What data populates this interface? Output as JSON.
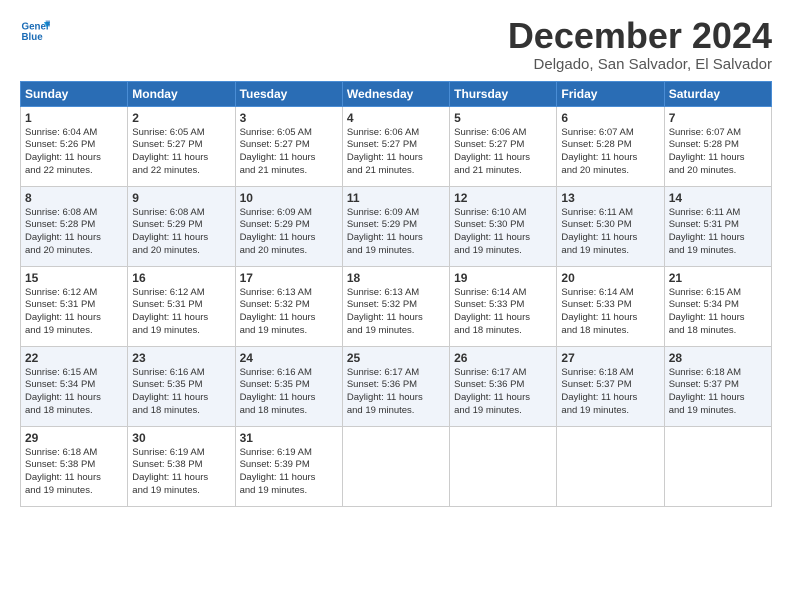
{
  "logo": {
    "line1": "General",
    "line2": "Blue"
  },
  "title": "December 2024",
  "location": "Delgado, San Salvador, El Salvador",
  "days_header": [
    "Sunday",
    "Monday",
    "Tuesday",
    "Wednesday",
    "Thursday",
    "Friday",
    "Saturday"
  ],
  "weeks": [
    [
      {
        "day": "1",
        "info": "Sunrise: 6:04 AM\nSunset: 5:26 PM\nDaylight: 11 hours\nand 22 minutes."
      },
      {
        "day": "2",
        "info": "Sunrise: 6:05 AM\nSunset: 5:27 PM\nDaylight: 11 hours\nand 22 minutes."
      },
      {
        "day": "3",
        "info": "Sunrise: 6:05 AM\nSunset: 5:27 PM\nDaylight: 11 hours\nand 21 minutes."
      },
      {
        "day": "4",
        "info": "Sunrise: 6:06 AM\nSunset: 5:27 PM\nDaylight: 11 hours\nand 21 minutes."
      },
      {
        "day": "5",
        "info": "Sunrise: 6:06 AM\nSunset: 5:27 PM\nDaylight: 11 hours\nand 21 minutes."
      },
      {
        "day": "6",
        "info": "Sunrise: 6:07 AM\nSunset: 5:28 PM\nDaylight: 11 hours\nand 20 minutes."
      },
      {
        "day": "7",
        "info": "Sunrise: 6:07 AM\nSunset: 5:28 PM\nDaylight: 11 hours\nand 20 minutes."
      }
    ],
    [
      {
        "day": "8",
        "info": "Sunrise: 6:08 AM\nSunset: 5:28 PM\nDaylight: 11 hours\nand 20 minutes."
      },
      {
        "day": "9",
        "info": "Sunrise: 6:08 AM\nSunset: 5:29 PM\nDaylight: 11 hours\nand 20 minutes."
      },
      {
        "day": "10",
        "info": "Sunrise: 6:09 AM\nSunset: 5:29 PM\nDaylight: 11 hours\nand 20 minutes."
      },
      {
        "day": "11",
        "info": "Sunrise: 6:09 AM\nSunset: 5:29 PM\nDaylight: 11 hours\nand 19 minutes."
      },
      {
        "day": "12",
        "info": "Sunrise: 6:10 AM\nSunset: 5:30 PM\nDaylight: 11 hours\nand 19 minutes."
      },
      {
        "day": "13",
        "info": "Sunrise: 6:11 AM\nSunset: 5:30 PM\nDaylight: 11 hours\nand 19 minutes."
      },
      {
        "day": "14",
        "info": "Sunrise: 6:11 AM\nSunset: 5:31 PM\nDaylight: 11 hours\nand 19 minutes."
      }
    ],
    [
      {
        "day": "15",
        "info": "Sunrise: 6:12 AM\nSunset: 5:31 PM\nDaylight: 11 hours\nand 19 minutes."
      },
      {
        "day": "16",
        "info": "Sunrise: 6:12 AM\nSunset: 5:31 PM\nDaylight: 11 hours\nand 19 minutes."
      },
      {
        "day": "17",
        "info": "Sunrise: 6:13 AM\nSunset: 5:32 PM\nDaylight: 11 hours\nand 19 minutes."
      },
      {
        "day": "18",
        "info": "Sunrise: 6:13 AM\nSunset: 5:32 PM\nDaylight: 11 hours\nand 19 minutes."
      },
      {
        "day": "19",
        "info": "Sunrise: 6:14 AM\nSunset: 5:33 PM\nDaylight: 11 hours\nand 18 minutes."
      },
      {
        "day": "20",
        "info": "Sunrise: 6:14 AM\nSunset: 5:33 PM\nDaylight: 11 hours\nand 18 minutes."
      },
      {
        "day": "21",
        "info": "Sunrise: 6:15 AM\nSunset: 5:34 PM\nDaylight: 11 hours\nand 18 minutes."
      }
    ],
    [
      {
        "day": "22",
        "info": "Sunrise: 6:15 AM\nSunset: 5:34 PM\nDaylight: 11 hours\nand 18 minutes."
      },
      {
        "day": "23",
        "info": "Sunrise: 6:16 AM\nSunset: 5:35 PM\nDaylight: 11 hours\nand 18 minutes."
      },
      {
        "day": "24",
        "info": "Sunrise: 6:16 AM\nSunset: 5:35 PM\nDaylight: 11 hours\nand 18 minutes."
      },
      {
        "day": "25",
        "info": "Sunrise: 6:17 AM\nSunset: 5:36 PM\nDaylight: 11 hours\nand 19 minutes."
      },
      {
        "day": "26",
        "info": "Sunrise: 6:17 AM\nSunset: 5:36 PM\nDaylight: 11 hours\nand 19 minutes."
      },
      {
        "day": "27",
        "info": "Sunrise: 6:18 AM\nSunset: 5:37 PM\nDaylight: 11 hours\nand 19 minutes."
      },
      {
        "day": "28",
        "info": "Sunrise: 6:18 AM\nSunset: 5:37 PM\nDaylight: 11 hours\nand 19 minutes."
      }
    ],
    [
      {
        "day": "29",
        "info": "Sunrise: 6:18 AM\nSunset: 5:38 PM\nDaylight: 11 hours\nand 19 minutes."
      },
      {
        "day": "30",
        "info": "Sunrise: 6:19 AM\nSunset: 5:38 PM\nDaylight: 11 hours\nand 19 minutes."
      },
      {
        "day": "31",
        "info": "Sunrise: 6:19 AM\nSunset: 5:39 PM\nDaylight: 11 hours\nand 19 minutes."
      },
      {
        "day": "",
        "info": ""
      },
      {
        "day": "",
        "info": ""
      },
      {
        "day": "",
        "info": ""
      },
      {
        "day": "",
        "info": ""
      }
    ]
  ]
}
